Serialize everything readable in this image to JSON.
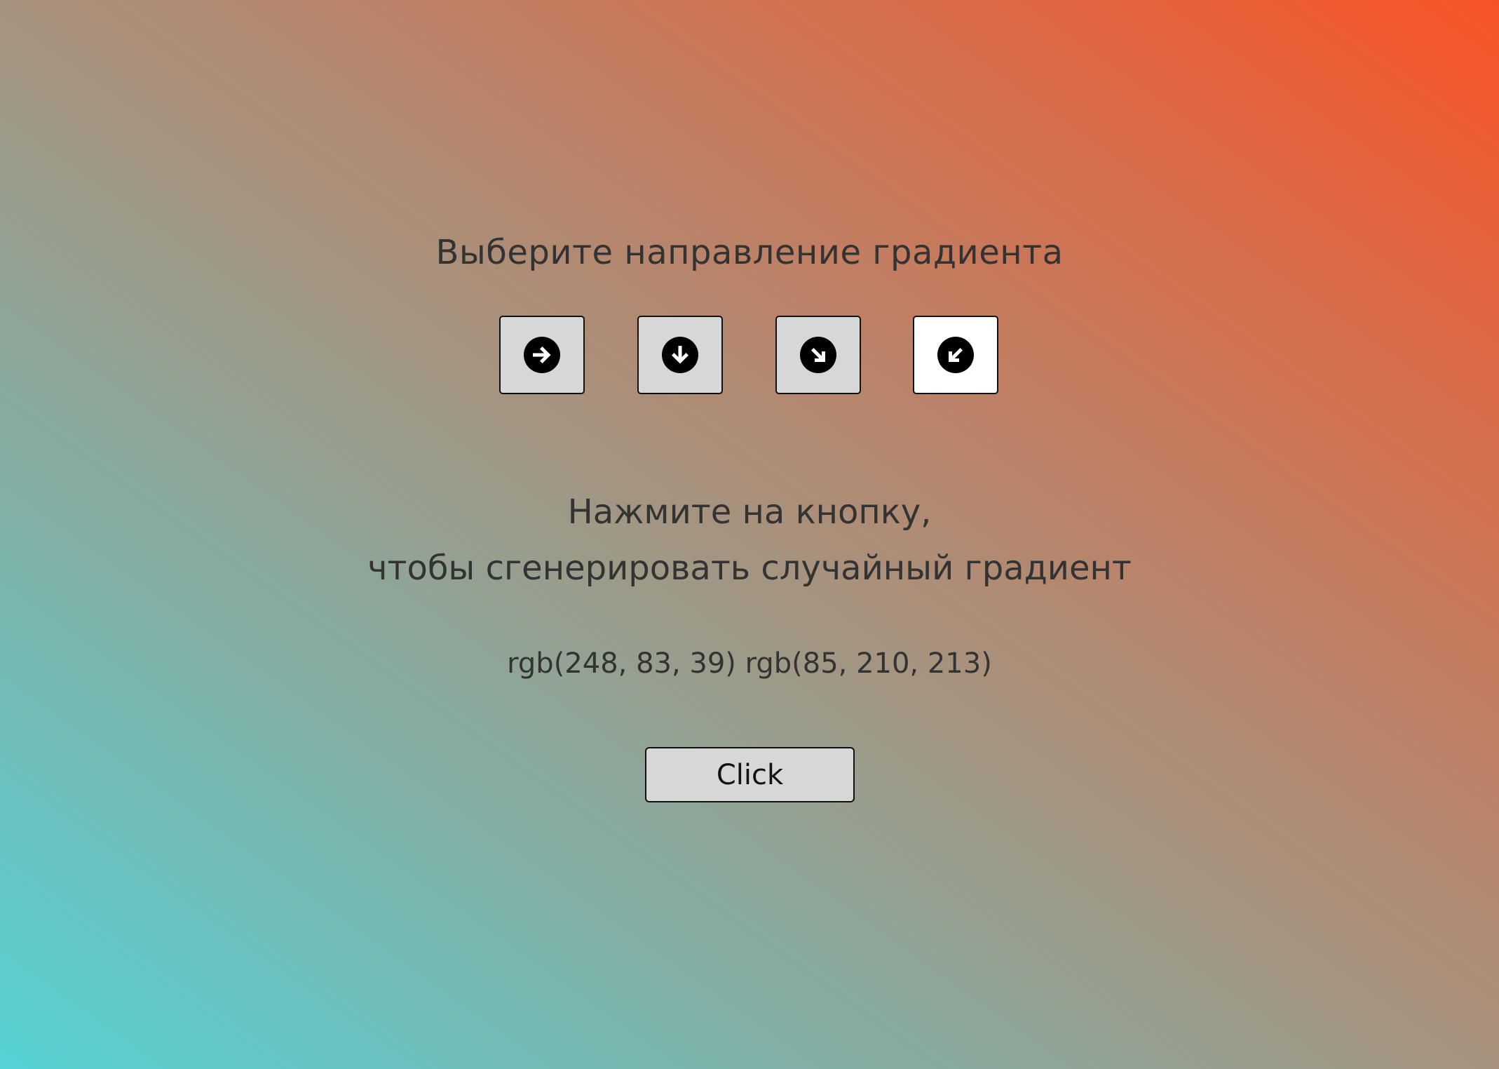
{
  "page": {
    "heading": "Выберите направление градиента",
    "gradient_colors": {
      "from": "#f85327",
      "to": "#55d2d5"
    }
  },
  "direction_buttons": [
    {
      "icon": "arrow-right-circle-icon",
      "direction": "right",
      "selected": false
    },
    {
      "icon": "arrow-down-circle-icon",
      "direction": "down",
      "selected": false
    },
    {
      "icon": "arrow-down-right-circle-icon",
      "direction": "down-right",
      "selected": false
    },
    {
      "icon": "arrow-down-left-circle-icon",
      "direction": "down-left",
      "selected": true
    }
  ],
  "prompt": {
    "line1": "Нажмите на кнопку,",
    "line2": "чтобы сгенерировать случайный градиент"
  },
  "color_readout": "rgb(248, 83, 39) rgb(85, 210, 213)",
  "generate_button": {
    "label": "Click"
  }
}
